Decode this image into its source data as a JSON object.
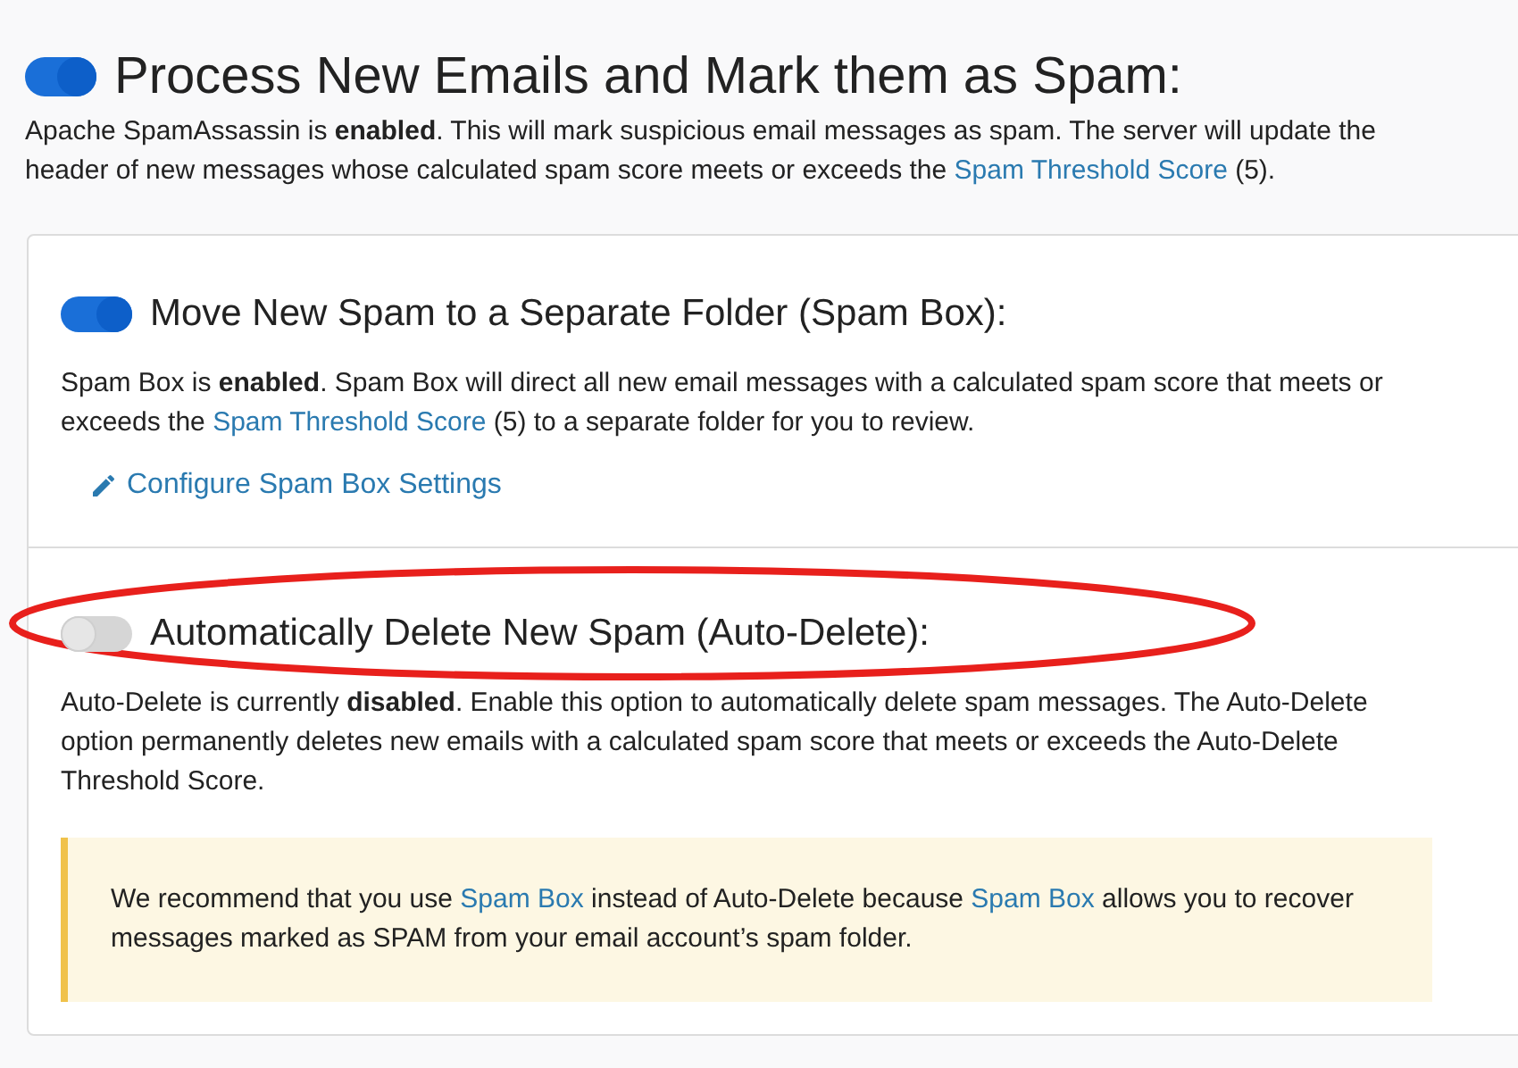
{
  "main": {
    "title": "Process New Emails and Mark them as Spam:",
    "on": true,
    "description": [
      {
        "kind": "plain",
        "text": "Apache SpamAssassin is "
      },
      {
        "kind": "bold",
        "text": "enabled"
      },
      {
        "kind": "plain",
        "text": ". This will mark suspicious email messages as spam. The server will update the header of new messages whose calculated spam score meets or exceeds the "
      },
      {
        "kind": "link",
        "text": "Spam Threshold Score"
      },
      {
        "kind": "plain",
        "text": " (5)."
      }
    ]
  },
  "sections": [
    {
      "title": "Move New Spam to a Separate Folder (Spam Box):",
      "on": true,
      "description": [
        {
          "kind": "plain",
          "text": "Spam Box is "
        },
        {
          "kind": "bold",
          "text": "enabled"
        },
        {
          "kind": "plain",
          "text": ". Spam Box will direct all new email messages with a calculated spam score that meets or exceeds the "
        },
        {
          "kind": "link",
          "text": "Spam Threshold Score"
        },
        {
          "kind": "plain",
          "text": " (5) to a separate folder for you to review."
        }
      ],
      "action_link": "Configure Spam Box Settings"
    },
    {
      "title": "Automatically Delete New Spam (Auto-Delete):",
      "on": false,
      "annotation": {
        "kind": "ellipse"
      },
      "description": [
        {
          "kind": "plain",
          "text": "Auto-Delete is currently "
        },
        {
          "kind": "bold",
          "text": "disabled"
        },
        {
          "kind": "plain",
          "text": ". Enable this option to automatically delete spam messages. The Auto-Delete option permanently deletes new emails with a calculated spam score that meets or exceeds the Auto-Delete Threshold Score."
        }
      ],
      "alert": [
        {
          "kind": "plain",
          "text": "We recommend that you use "
        },
        {
          "kind": "link",
          "text": "Spam Box"
        },
        {
          "kind": "plain",
          "text": " instead of Auto-Delete because "
        },
        {
          "kind": "link",
          "text": "Spam Box"
        },
        {
          "kind": "plain",
          "text": " allows you to recover messages marked as SPAM from your email account’s spam folder."
        }
      ]
    }
  ]
}
